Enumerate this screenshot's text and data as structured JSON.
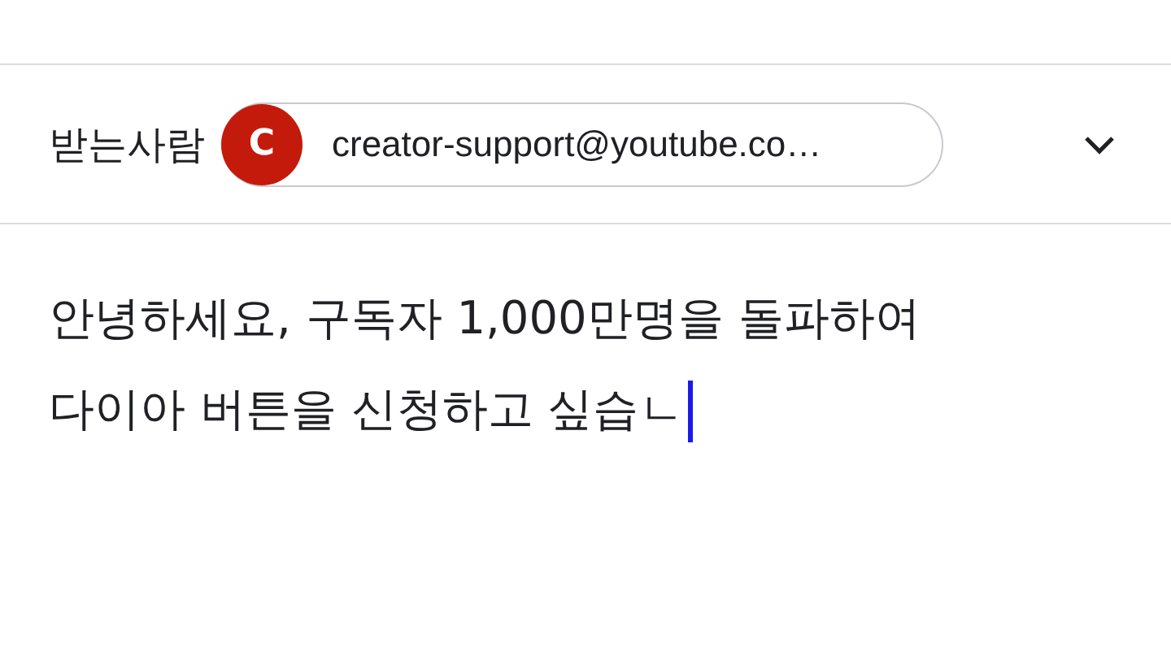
{
  "recipient_row": {
    "label": "받는사람",
    "recipient": {
      "initial": "C",
      "address": "creator-support@youtube.co…",
      "color": "#c41a0b"
    },
    "expanded": false
  },
  "body": {
    "value": "안녕하세요, 구독자 1,000만명을 돌파하여\n다이아 버튼을 신청하고 싶습ㄴ",
    "focused": true
  }
}
